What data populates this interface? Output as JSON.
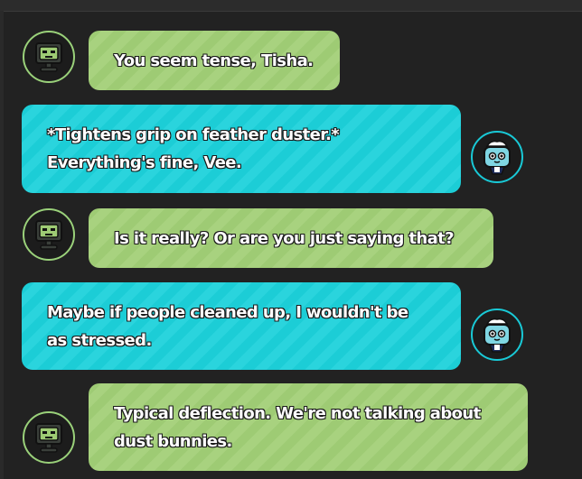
{
  "characters": {
    "vee": {
      "name": "Vee",
      "accent": "#9ecb74"
    },
    "tisha": {
      "name": "Tisha",
      "accent": "#1ccdd6"
    }
  },
  "messages": [
    {
      "speaker": "vee",
      "text": "You seem tense, Tisha."
    },
    {
      "speaker": "tisha",
      "line1": "*Tightens grip on feather duster.*",
      "line2": "Everything's fine, Vee."
    },
    {
      "speaker": "vee",
      "text": "Is it really? Or are you just saying that?"
    },
    {
      "speaker": "tisha",
      "line1": "Maybe if people cleaned up, I wouldn't be",
      "line2": "as stressed."
    },
    {
      "speaker": "vee",
      "line1": "Typical deflection. We're not talking about",
      "line2": "dust bunnies."
    }
  ]
}
